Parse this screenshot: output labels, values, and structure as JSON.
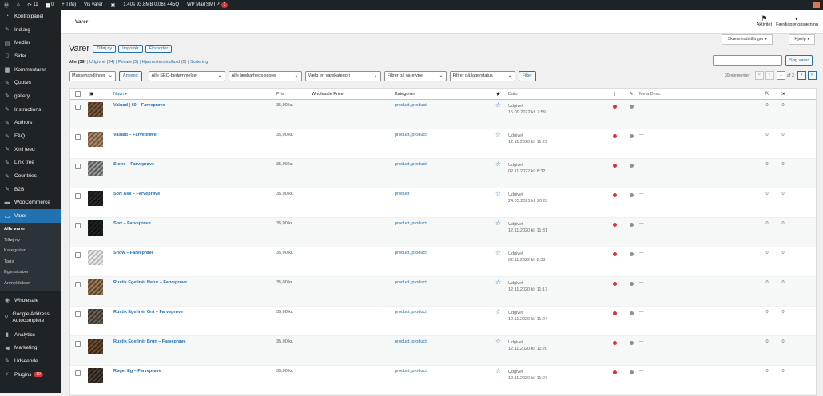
{
  "adminbar": {
    "wp_logo": "W",
    "home": "⌂",
    "updates": "11",
    "comments": "0",
    "new": "+ Tilføj",
    "view": "Vis varer",
    "perf": "1,40s 93,8MB 0,06s 445Q",
    "smtp": "WP Mail SMTP",
    "smtp_badge": "1"
  },
  "sidebar": {
    "items": [
      {
        "label": "Kontrolpanel",
        "icon": "dashboard-icon"
      },
      {
        "label": "Indlæg",
        "icon": "pin-icon"
      },
      {
        "label": "Medier",
        "icon": "media-icon"
      },
      {
        "label": "Sider",
        "icon": "page-icon"
      },
      {
        "label": "Kommentarer",
        "icon": "comment-icon"
      },
      {
        "label": "Quotes",
        "icon": "pin-icon"
      },
      {
        "label": "gallery",
        "icon": "pin-icon"
      },
      {
        "label": "Instructions",
        "icon": "pin-icon"
      },
      {
        "label": "Authors",
        "icon": "pin-icon"
      },
      {
        "label": "FAQ",
        "icon": "pin-icon"
      },
      {
        "label": "Xml feed",
        "icon": "pin-icon"
      },
      {
        "label": "Link tree",
        "icon": "pin-icon"
      },
      {
        "label": "Countries",
        "icon": "pin-icon"
      },
      {
        "label": "B2B",
        "icon": "pin-icon"
      },
      {
        "label": "WooCommerce",
        "icon": "woo-icon"
      },
      {
        "label": "Varer",
        "icon": "archive-icon"
      }
    ],
    "sub": [
      "Alle varer",
      "Tilføj ny",
      "Kategorier",
      "Tags",
      "Egenskaber",
      "Anmeldelser"
    ],
    "items2": [
      {
        "label": "Wholesale",
        "icon": "wholesale-icon"
      },
      {
        "label": "Google Address Autocomplete",
        "icon": "location-icon"
      },
      {
        "label": "Analytics",
        "icon": "chart-icon"
      },
      {
        "label": "Marketing",
        "icon": "megaphone-icon"
      },
      {
        "label": "Udseende",
        "icon": "brush-icon"
      },
      {
        "label": "Plugins",
        "icon": "plugin-icon",
        "badge": "10"
      }
    ]
  },
  "topbar": {
    "crumb": "Varer",
    "activity": "Aktivitet",
    "setup": "Færdiggør opsætning"
  },
  "screen_options": "Skærmindstillinger ▾",
  "help": "Hjælp ▾",
  "page": {
    "title": "Varer",
    "add_new": "Tilføj ny",
    "import": "Importér",
    "export": "Eksportér"
  },
  "views": {
    "all": "Alle",
    "all_count": "(39)",
    "published": "Udgivne",
    "published_count": "(34)",
    "private": "Private",
    "private_count": "(5)",
    "cornerstone": "Hjørnestensindhold",
    "cornerstone_count": "(0)",
    "sort": "Sortering"
  },
  "search": {
    "button": "Søg varer"
  },
  "filters": {
    "bulk": "Massehandlinger",
    "apply": "Anvend",
    "seo": "Alle SEO-bedømmelser",
    "readability": "Alle læsbarheds-scorer",
    "category": "Vælg en varekategori",
    "type": "Filtrer på varetype",
    "stock": "Filtrer på lagerstatus",
    "filter": "Filter"
  },
  "pagination": {
    "count": "39 elementer",
    "first": "«",
    "prev": "‹",
    "current": "1",
    "of": "af 2",
    "next": "›",
    "last": "»"
  },
  "table": {
    "headers": {
      "name": "Navn ▾",
      "price": "Pris",
      "wholesale": "Wholesale Price",
      "categories": "Kategorier",
      "date": "Dato",
      "meta": "Meta Desc."
    },
    "rows": [
      {
        "name": "Valnød | 60 – Farveprøve",
        "price": "35,00 kr.",
        "cat": "product, product",
        "status": "Udgivet",
        "date": "15.09.2022 kl. 7:59",
        "meta": "—",
        "l1": "0",
        "l2": "0",
        "thumb": "wood-brown"
      },
      {
        "name": "Valnød – Farveprøve",
        "price": "35,00 kr.",
        "cat": "product, product",
        "status": "Udgivet",
        "date": "12.11.2020 kl. 11:29",
        "meta": "—",
        "l1": "0",
        "l2": "0",
        "thumb": "wood-light"
      },
      {
        "name": "Stone – Farveprøve",
        "price": "35,00 kr.",
        "cat": "product, product",
        "status": "Udgivet",
        "date": "02.11.2022 kl. 8:32",
        "meta": "—",
        "l1": "0",
        "l2": "0",
        "thumb": "stone-grey"
      },
      {
        "name": "Sort Ask – Farveprøve",
        "price": "35,00 kr.",
        "cat": "product",
        "status": "Udgivet",
        "date": "24.05.2021 kl. 20:01",
        "meta": "—",
        "l1": "0",
        "l2": "0",
        "thumb": "black"
      },
      {
        "name": "Sort – Farveprøve",
        "price": "35,00 kr.",
        "cat": "product, product",
        "status": "Udgivet",
        "date": "12.11.2020 kl. 11:31",
        "meta": "—",
        "l1": "0",
        "l2": "0",
        "thumb": "black-dark"
      },
      {
        "name": "Snow – Farveprøve",
        "price": "35,00 kr.",
        "cat": "product, product",
        "status": "Udgivet",
        "date": "02.11.2022 kl. 8:33",
        "meta": "—",
        "l1": "0",
        "l2": "0",
        "thumb": "snow-white"
      },
      {
        "name": "Rustik Egefinér Natur – Farveprøve",
        "price": "35,00 kr.",
        "cat": "product, product",
        "status": "Udgivet",
        "date": "12.11.2020 kl. 11:17",
        "meta": "—",
        "l1": "0",
        "l2": "0",
        "thumb": "wood-natur"
      },
      {
        "name": "Rustik Egefinér Grå – Farveprøve",
        "price": "35,00 kr.",
        "cat": "product, product",
        "status": "Udgivet",
        "date": "12.11.2020 kl. 11:24",
        "meta": "—",
        "l1": "0",
        "l2": "0",
        "thumb": "wood-grey"
      },
      {
        "name": "Rustik Egefinér Brun – Farveprøve",
        "price": "35,00 kr.",
        "cat": "product, product",
        "status": "Udgivet",
        "date": "12.11.2020 kl. 11:20",
        "meta": "—",
        "l1": "0",
        "l2": "0",
        "thumb": "wood-dark"
      },
      {
        "name": "Røget Eg – Farveprøve",
        "price": "35,00 kr.",
        "cat": "product, product",
        "status": "Udgivet",
        "date": "12.11.2020 kl. 11:27",
        "meta": "—",
        "l1": "0",
        "l2": "0",
        "thumb": "smoked"
      }
    ]
  },
  "colors": {
    "accent": "#2271b1",
    "seo_bad": "#d63638",
    "readability_na": "#8c8f94"
  }
}
